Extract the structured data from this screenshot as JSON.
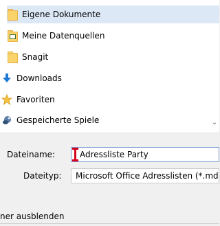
{
  "navigation": {
    "items": [
      {
        "label": "Eigene Dokumente",
        "icon": "folder-icon",
        "selected": true
      },
      {
        "label": "Meine Datenquellen",
        "icon": "data-sources-folder-icon",
        "selected": false
      },
      {
        "label": "Snagit",
        "icon": "folder-icon",
        "selected": false
      },
      {
        "label": "Downloads",
        "icon": "download-arrow-icon",
        "selected": false
      },
      {
        "label": "Favoriten",
        "icon": "star-icon",
        "selected": false
      },
      {
        "label": "Gespeicherte Spiele",
        "icon": "saved-games-icon",
        "selected": false
      }
    ]
  },
  "form": {
    "filename_label": "Dateiname:",
    "filename_value": "Adressliste Party",
    "filetype_label": "Dateityp:",
    "filetype_value": "Microsoft Office Adresslisten (*.mdb)"
  },
  "footer": {
    "hide_folders_text": "ner ausblenden"
  },
  "colors": {
    "selection_bg": "#dde8f6",
    "folder_yellow": "#fbd36b",
    "caret_red": "#d6001c",
    "downloads_blue": "#1e78d6"
  }
}
